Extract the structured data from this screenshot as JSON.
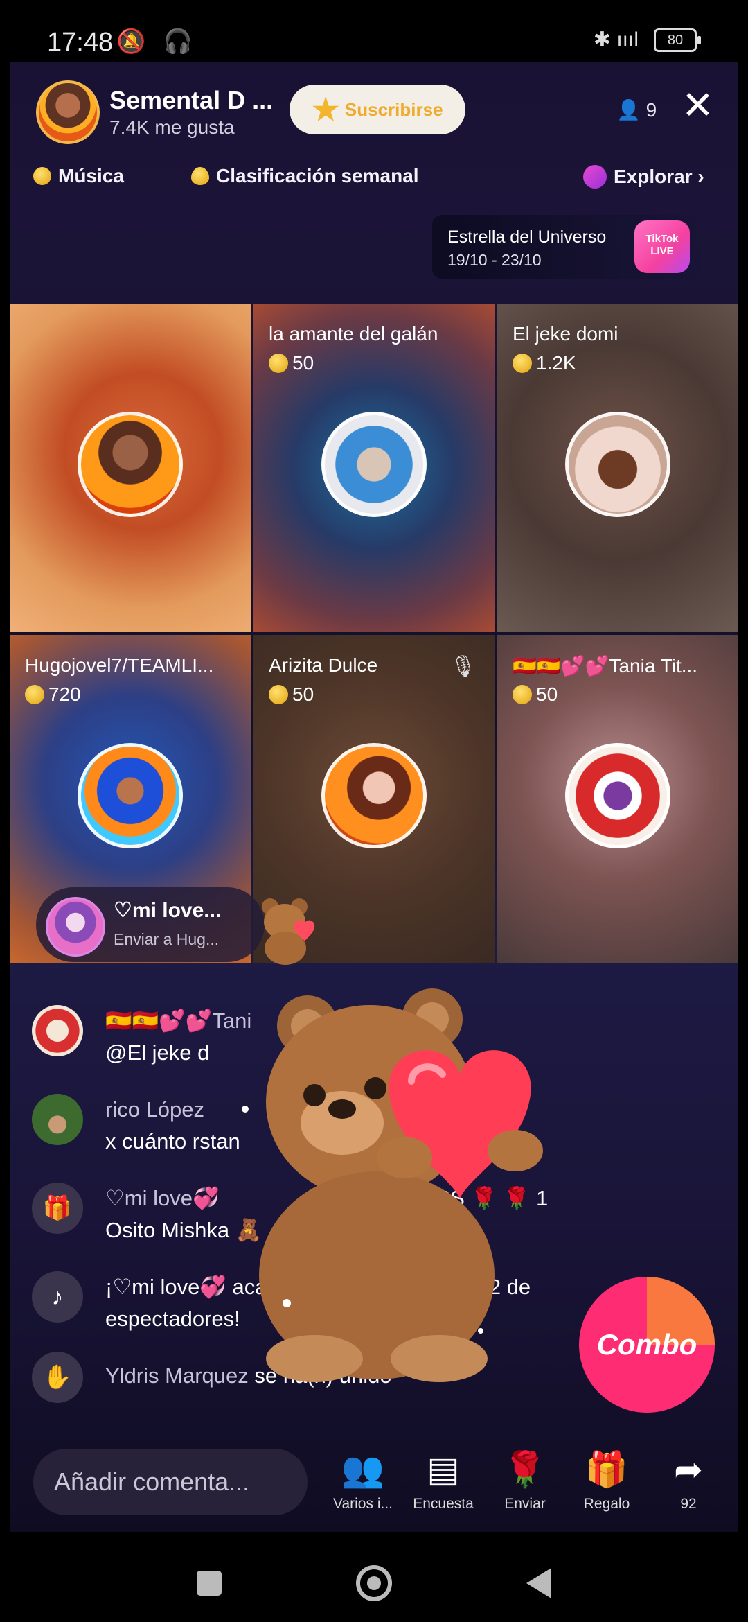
{
  "status_bar": {
    "time": "17:48",
    "left_icons": "🔕 🎧",
    "signal": "✱ ıııl",
    "battery": "80"
  },
  "host": {
    "name": "Semental D ...",
    "likes": "7.4K me gusta",
    "subscribe_label": "Suscribirse",
    "viewer_count": "9"
  },
  "chips": {
    "music": "Música",
    "weekly": "Clasificación semanal",
    "explore": "Explorar ›"
  },
  "event": {
    "title": "Estrella del Universo",
    "dates": "19/10 - 23/10",
    "badge": "TikTok LIVE"
  },
  "tiles": [
    {
      "name": "",
      "coins": ""
    },
    {
      "name": "la amante del galán",
      "coins": "50"
    },
    {
      "name": "El jeke domi",
      "coins": "1.2K"
    },
    {
      "name": "Hugojovel7/TEAMLI...",
      "coins": "720"
    },
    {
      "name": "Arizita Dulce",
      "coins": "50"
    },
    {
      "name": "🇪🇸🇪🇸💕💕Tania Tit...",
      "coins": "50"
    }
  ],
  "gift_toast": {
    "sender": "♡mi love...",
    "subtitle": "Enviar a Hug..."
  },
  "chat": [
    {
      "name": "🇪🇸🇪🇸💕💕Tani",
      "body": "@El jeke d",
      "icon": "avatar"
    },
    {
      "name": "rico López",
      "body": "x cuánto rstan",
      "icon": "avatar"
    },
    {
      "name": "♡mi love💞",
      "body": "Osito Mishka 🧸",
      "extra": "EAMLISS 🌹 🌹 1",
      "icon": "gift-icon"
    },
    {
      "name": "¡♡mi love💞 acaba",
      "body": "espectadores!",
      "extra": "p 2 de",
      "icon": "tiktok-icon"
    },
    {
      "name": "Yldris Marquez",
      "body": "se ha(n) unido",
      "icon": "wave-icon"
    }
  ],
  "combo_label": "Combo",
  "bottom": {
    "comment_placeholder": "Añadir comenta...",
    "actions": [
      {
        "label": "Varios i...",
        "icon": "people-icon"
      },
      {
        "label": "Encuesta",
        "icon": "poll-icon"
      },
      {
        "label": "Enviar",
        "icon": "rose-icon"
      },
      {
        "label": "Regalo",
        "icon": "gift-icon"
      },
      {
        "label": "92",
        "icon": "share-icon"
      }
    ]
  },
  "colors": {
    "accent_pink": "#fe2c73",
    "accent_orange": "#f8783f",
    "gold": "#f2b52b"
  }
}
